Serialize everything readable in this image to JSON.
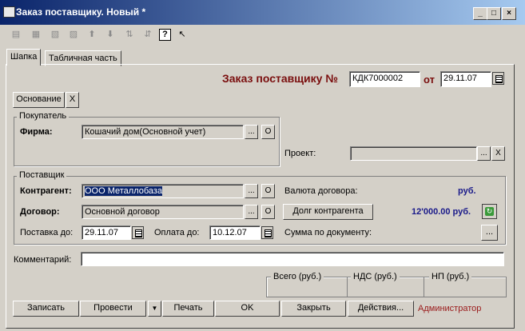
{
  "window": {
    "title": "Заказ поставщику. Новый *",
    "min": "_",
    "max": "□",
    "close": "×"
  },
  "toolbar": {
    "icons": [
      "copy-icon",
      "table-icon",
      "edit-icon",
      "delete-icon",
      "up-icon",
      "down-icon",
      "sort-asc-icon",
      "sort-desc-icon",
      "help-icon",
      "pointer-icon"
    ]
  },
  "tabs": [
    "Шапка",
    "Табличная часть"
  ],
  "header": {
    "title": "Заказ поставщику №",
    "number": "КДК7000002",
    "from_label": "от",
    "date": "29.11.07"
  },
  "basis": {
    "label": "Основание",
    "clear": "X"
  },
  "buyer": {
    "group_title": "Покупатель",
    "firm_label": "Фирма:",
    "firm_value": "Кошачий дом(Основной учет)",
    "o": "О"
  },
  "project": {
    "label": "Проект:",
    "value": "",
    "clear": "X"
  },
  "supplier": {
    "group_title": "Поставщик",
    "counterparty_label": "Контрагент:",
    "counterparty_value": "ООО Металлобаза",
    "contract_label": "Договор:",
    "contract_value": "Основной договор",
    "currency_label": "Валюта договора:",
    "currency_value": "руб.",
    "debt_button": "Долг контрагента",
    "debt_value": "12'000.00 руб.",
    "delivery_label": "Поставка до:",
    "delivery_date": "29.11.07",
    "payment_label": "Оплата до:",
    "payment_date": "10.12.07",
    "doc_sum_label": "Сумма по документу:",
    "o": "О",
    "dots": "..."
  },
  "comment": {
    "label": "Комментарий:",
    "value": ""
  },
  "totals": {
    "total": "Всего (руб.)",
    "vat": "НДС (руб.)",
    "np": "НП (руб.)"
  },
  "buttons": {
    "save": "Записать",
    "post": "Провести",
    "print": "Печать",
    "ok": "OK",
    "close": "Закрыть",
    "actions": "Действия...",
    "user": "Администратор"
  }
}
